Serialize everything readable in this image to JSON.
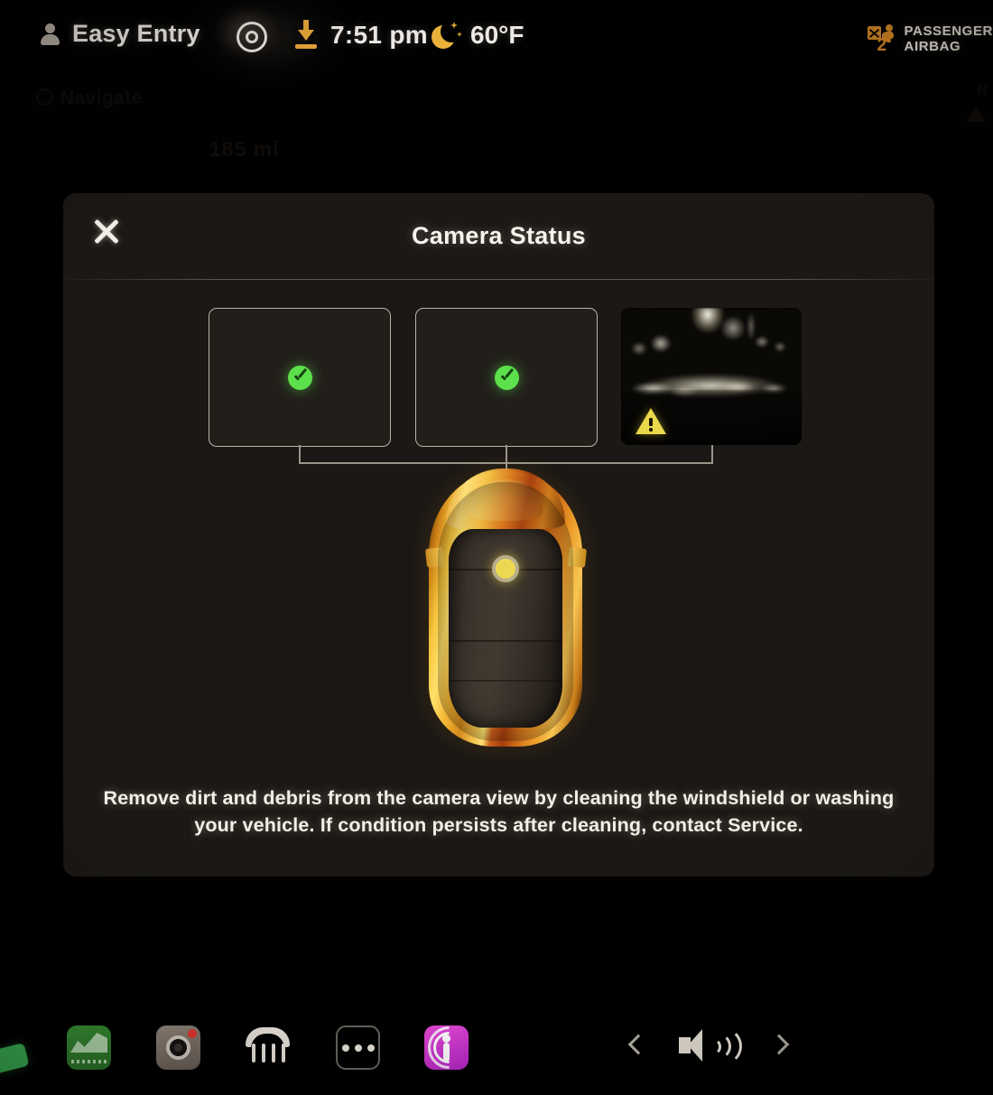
{
  "statusbar": {
    "profile_label": "Easy Entry",
    "profile_icon": "person-icon",
    "sentry_icon": "sentry-mode-icon",
    "download_icon": "software-download-icon",
    "time": "7:51 pm",
    "weather_icon": "moon-night-icon",
    "temperature": "60°F",
    "airbag": {
      "icon": "passenger-airbag-off-icon",
      "number": "2",
      "line1": "PASSENGER",
      "line2": "AIRBAG"
    }
  },
  "background": {
    "search_placeholder": "Navigate",
    "mid_text": "185 mi",
    "right_text": "N",
    "arrow_icon": "navigation-arrow-icon"
  },
  "modal": {
    "title": "Camera Status",
    "close_icon": "close-icon",
    "cameras": [
      {
        "name": "camera-left",
        "status": "ok",
        "status_icon": "check-circle-icon"
      },
      {
        "name": "camera-center",
        "status": "ok",
        "status_icon": "check-circle-icon"
      },
      {
        "name": "camera-right",
        "status": "warning",
        "status_icon": "warning-triangle-icon"
      }
    ],
    "vehicle": {
      "name": "vehicle-top-view",
      "marker_icon": "camera-location-marker-icon",
      "color": "#f0a42a"
    },
    "instruction": "Remove dirt and debris from the camera view by cleaning the windshield or washing your vehicle. If condition persists after cleaning, contact Service."
  },
  "appbar": {
    "apps": [
      {
        "name": "app-green-partial",
        "label": ""
      },
      {
        "name": "app-stocks",
        "label": ""
      },
      {
        "name": "app-dashcam",
        "label": ""
      },
      {
        "name": "app-defrost",
        "label": ""
      },
      {
        "name": "app-more",
        "label": ""
      },
      {
        "name": "app-podcast",
        "label": ""
      }
    ],
    "prev_icon": "chevron-left-icon",
    "volume_icon": "volume-speaker-icon",
    "next_icon": "chevron-right-icon"
  },
  "colors": {
    "accent_amber": "#e9a93a",
    "status_ok": "#5ce04c",
    "status_warn": "#e9d94a",
    "panel_bg": "#1b1815",
    "text": "#f4efe6"
  }
}
